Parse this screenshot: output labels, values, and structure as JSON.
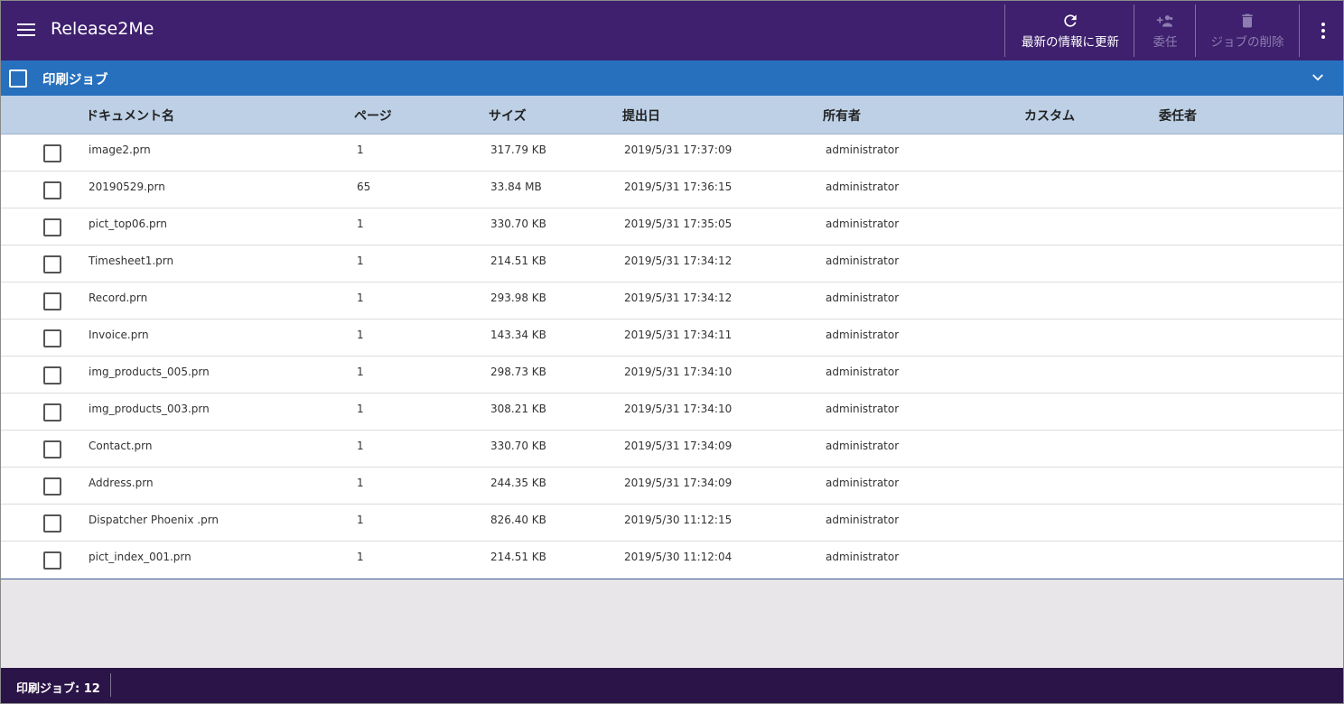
{
  "app": {
    "title": "Release2Me"
  },
  "toolbar": {
    "refresh_label": "最新の情報に更新",
    "delegate_label": "委任",
    "delete_label": "ジョブの削除"
  },
  "section": {
    "title": "印刷ジョブ"
  },
  "columns": {
    "document": "ドキュメント名",
    "pages": "ページ",
    "size": "サイズ",
    "submitted": "提出日",
    "owner": "所有者",
    "custom": "カスタム",
    "delegate": "委任者"
  },
  "jobs": [
    {
      "document": "image2.prn",
      "pages": "1",
      "size": "317.79 KB",
      "submitted": "2019/5/31 17:37:09",
      "owner": "administrator"
    },
    {
      "document": "20190529.prn",
      "pages": "65",
      "size": "33.84 MB",
      "submitted": "2019/5/31 17:36:15",
      "owner": "administrator"
    },
    {
      "document": "pict_top06.prn",
      "pages": "1",
      "size": "330.70 KB",
      "submitted": "2019/5/31 17:35:05",
      "owner": "administrator"
    },
    {
      "document": "Timesheet1.prn",
      "pages": "1",
      "size": "214.51 KB",
      "submitted": "2019/5/31 17:34:12",
      "owner": "administrator"
    },
    {
      "document": "Record.prn",
      "pages": "1",
      "size": "293.98 KB",
      "submitted": "2019/5/31 17:34:12",
      "owner": "administrator"
    },
    {
      "document": "Invoice.prn",
      "pages": "1",
      "size": "143.34 KB",
      "submitted": "2019/5/31 17:34:11",
      "owner": "administrator"
    },
    {
      "document": "img_products_005.prn",
      "pages": "1",
      "size": "298.73 KB",
      "submitted": "2019/5/31 17:34:10",
      "owner": "administrator"
    },
    {
      "document": "img_products_003.prn",
      "pages": "1",
      "size": "308.21 KB",
      "submitted": "2019/5/31 17:34:10",
      "owner": "administrator"
    },
    {
      "document": "Contact.prn",
      "pages": "1",
      "size": "330.70 KB",
      "submitted": "2019/5/31 17:34:09",
      "owner": "administrator"
    },
    {
      "document": "Address.prn",
      "pages": "1",
      "size": "244.35 KB",
      "submitted": "2019/5/31 17:34:09",
      "owner": "administrator"
    },
    {
      "document": "Dispatcher Phoenix .prn",
      "pages": "1",
      "size": "826.40 KB",
      "submitted": "2019/5/30 11:12:15",
      "owner": "administrator"
    },
    {
      "document": "pict_index_001.prn",
      "pages": "1",
      "size": "214.51 KB",
      "submitted": "2019/5/30 11:12:04",
      "owner": "administrator"
    }
  ],
  "status": {
    "job_count_text": "印刷ジョブ: 12"
  },
  "colors": {
    "appbar": "#3e206e",
    "section": "#2770bd",
    "header": "#bdd0e6",
    "statusbar": "#2b1448"
  },
  "icons": {
    "menu": "menu-icon",
    "refresh": "refresh-icon",
    "delegate": "add-user-icon",
    "delete": "trash-icon",
    "more": "more-vert-icon",
    "collapse": "chevron-down-icon"
  }
}
